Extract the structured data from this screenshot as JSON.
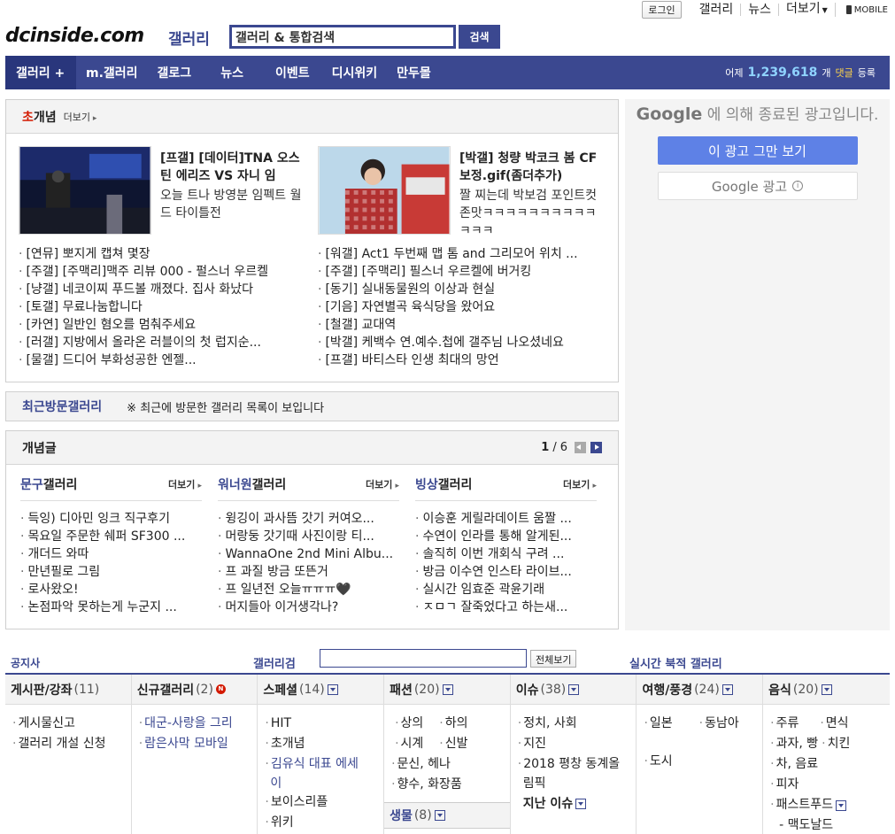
{
  "topbar": {
    "login": "로그인",
    "links": [
      "갤러리",
      "뉴스",
      "더보기"
    ],
    "mobile": "MOBILE"
  },
  "header": {
    "logo": "dcinside.com",
    "logo_sub": "갤러리",
    "search_placeholder": "갤러리 & 통합검색",
    "search_button": "검색"
  },
  "nav": {
    "items": [
      "갤러리 +",
      "m.갤러리",
      "갤로그",
      "뉴스",
      "이벤트",
      "디시위키",
      "만두몰"
    ],
    "yesterday_label": "어제",
    "yesterday_count": "1,239,618",
    "unit": "개",
    "comment": "댓글",
    "registered": "등록"
  },
  "concept": {
    "title_hi": "초",
    "title_rest": "개념",
    "more": "더보기",
    "features": [
      {
        "title": "[프갤] [데이터]TNA 오스틴 에리즈 VS 자니 임",
        "desc": "오늘 트나 방영분 임펙트 월드 타이틀전"
      },
      {
        "title": "[박갤] 청량 박코크 봄 CF 보정.gif(좀더추가)",
        "desc": "짤 찌는데 박보검 포인트컷 존맛ㅋㅋㅋㅋㅋㅋㅋㅋㅋㅋㅋㅋㅋ"
      }
    ],
    "left_list": [
      "[연뮤] 뽀지게 캡쳐 몇장",
      "[주갤] [주맥리]맥주 리뷰 000 - 펄스너 우르켈",
      "[냥갤] 네코이찌 푸드볼 깨졌다. 집사 화났다",
      "[토갤] 무료나눔합니다",
      "[카연] 일반인 혐오를 멈춰주세요",
      "[러갤] 지방에서 올라온 러블이의 첫 럽지순...",
      "[물갤] 드디어 부화성공한 엔젤..."
    ],
    "right_list": [
      "[워갤] Act1 두번째 맵 톰 and 그리모어 위치 ...",
      "[주갤] [주맥리] 필스너 우르켈에 버거킹",
      "[동기] 실내동물원의 이상과 현실",
      "[기음] 자연별곡 육식당을 왔어요",
      "[철갤] 교대역",
      "[박갤] 케백수 연.예수.첩에 갤주님 나오셨네요",
      "[프갤] 바티스타 인생 최대의 망언"
    ]
  },
  "recent": {
    "title": "최근방문갤러리",
    "message": "※ 최근에 방문한 갤러리 목록이 보입니다"
  },
  "concept_posts": {
    "title": "개념글",
    "page_current": "1",
    "page_sep": " / ",
    "page_total": "6",
    "columns": [
      {
        "name": "문구",
        "suffix": " 갤러리",
        "more": "더보기",
        "items": [
          "득잉) 디아민 잉크 직구후기",
          "목요일 주문한 쉐퍼 SF300 ...",
          "개더드 와따",
          "만년필로 그림",
          "로사왔오!",
          "논점파악 못하는게 누군지 ..."
        ]
      },
      {
        "name": "워너원",
        "suffix": " 갤러리",
        "more": "더보기",
        "items": [
          "윙깅이 과사뜸 갓기 커여오...",
          "머랑둥 갓기때 사진이랑 티...",
          "WannaOne 2nd Mini Albu...",
          "프 과질 방금 또뜬거",
          "프 일년전 오늘ㅠㅠㅠ🖤",
          "머지들아 이거생각나?"
        ]
      },
      {
        "name": "빙상",
        "suffix": " 갤러리",
        "more": "더보기",
        "items": [
          "이승훈 게릴라데이트 움짤 ...",
          "수연이 인라를 통해 알게된...",
          "솔직히 이번 개회식 구려 ...",
          "방금 이수연 인스타 라이브...",
          "실시간 임효준 곽윤기래",
          "ㅈㅁㄱ 잘죽었다고 하는새..."
        ]
      }
    ]
  },
  "ad": {
    "google": "Google",
    "text": "에 의해 종료된 광고입니다.",
    "stop_button": "이 광고 그만 보기",
    "google_ads": "Google 광고",
    "info": "i"
  },
  "bottom": {
    "notice": "공지사",
    "gallery_search": "갤러리검",
    "all_view": "전체보기",
    "realtime": "실시간 북적 갤러리"
  },
  "categories": [
    {
      "name": "게시판/강좌",
      "count": "(11)",
      "items": [
        "게시물신고",
        "갤러리 개설 신청"
      ]
    },
    {
      "name": "신규갤러리",
      "count": "(2)",
      "badge": "N",
      "items": [
        "대군-사랑을 그리",
        "람은사막 모바일"
      ]
    },
    {
      "name": "스페셜",
      "count": "(14)",
      "items": [
        "HIT",
        "초개념",
        "김유식 대표 에세",
        "이",
        "보이스리플",
        "위키"
      ]
    },
    {
      "name": "패션",
      "count": "(20)",
      "pairs": [
        [
          "상의",
          "하의"
        ],
        [
          "시계",
          "신발"
        ]
      ],
      "items": [
        "문신, 헤나",
        "향수, 화장품"
      ],
      "sub": "생물",
      "sub_count": "(8)"
    },
    {
      "name": "이슈",
      "count": "(38)",
      "items": [
        "정치, 사회",
        "지진",
        "2018 평창 동계올",
        "림픽"
      ],
      "past": "지난 이슈"
    },
    {
      "name": "여행/풍경",
      "count": "(24)",
      "pairs": [
        [
          "일본",
          "동남아"
        ]
      ],
      "items": [
        "도시"
      ]
    },
    {
      "name": "음식",
      "count": "(20)",
      "pairs": [
        [
          "주류",
          "면식"
        ],
        [
          "과자, 빵",
          "치킨"
        ]
      ],
      "items": [
        "차, 음료",
        "피자",
        "패스트푸드"
      ],
      "extra": "- 맥도날드"
    }
  ]
}
